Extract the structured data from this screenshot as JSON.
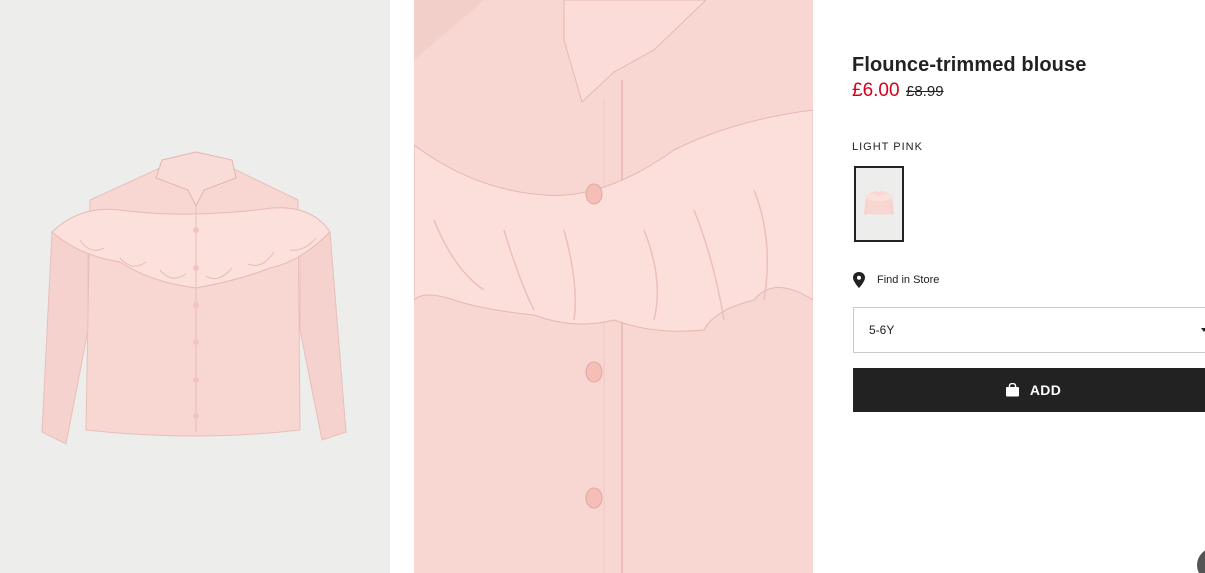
{
  "product": {
    "title": "Flounce-trimmed blouse",
    "price_sale": "£6.00",
    "price_original": "£8.99"
  },
  "color": {
    "name": "LIGHT PINK"
  },
  "store": {
    "find_in_store_label": "Find in Store",
    "icon": "location-pin-icon"
  },
  "size_selector": {
    "selected": "5-6Y"
  },
  "cart": {
    "add_label": "ADD",
    "icon": "shopping-bag-icon"
  },
  "images": {
    "main_alt": "Light pink flounce-trimmed blouse, front view",
    "detail_alt": "Close-up of flounce trim and buttons"
  },
  "colors": {
    "sale_price": "#d6001c",
    "button_bg": "#222222",
    "blouse": "#f8d7d3"
  }
}
